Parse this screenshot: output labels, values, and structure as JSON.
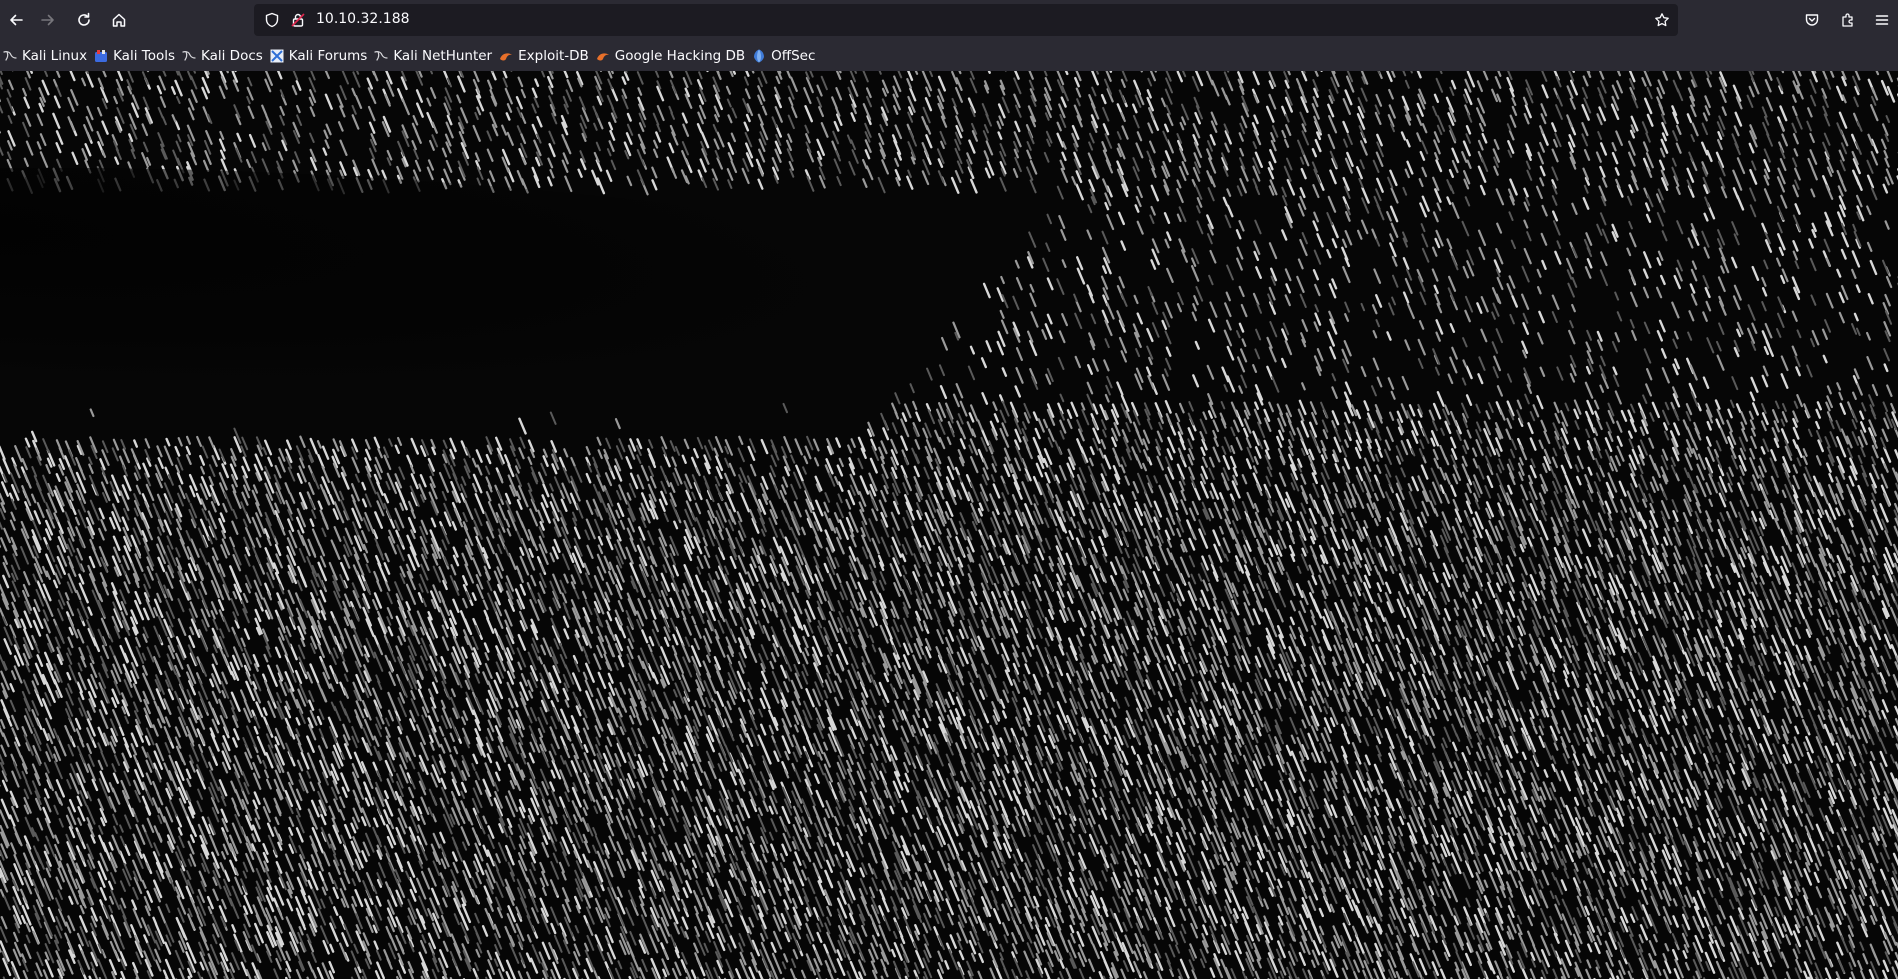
{
  "window": {
    "url": "10.10.32.188"
  },
  "toolbar": {
    "icons": [
      "back-arrow-icon",
      "forward-arrow-icon",
      "reload-icon",
      "home-icon",
      "tracking-shield-icon",
      "insecure-lock-icon",
      "bookmark-star-icon",
      "pocket-icon",
      "extensions-icon",
      "menu-icon"
    ]
  },
  "bookmarks": [
    {
      "label": "Kali Linux",
      "icon": "kali-dragon-icon"
    },
    {
      "label": "Kali Tools",
      "icon": "kali-tools-icon"
    },
    {
      "label": "Kali Docs",
      "icon": "kali-dragon-icon"
    },
    {
      "label": "Kali Forums",
      "icon": "kali-forums-icon"
    },
    {
      "label": "Kali NetHunter",
      "icon": "kali-dragon-icon"
    },
    {
      "label": "Exploit-DB",
      "icon": "exploit-db-icon"
    },
    {
      "label": "Google Hacking DB",
      "icon": "exploit-db-icon"
    },
    {
      "label": "OffSec",
      "icon": "offsec-icon"
    }
  ],
  "colors": {
    "chrome_bg": "#2b2a33",
    "urlbar_bg": "#1c1b22",
    "text": "#fbfbfe",
    "page_bg": "#050505",
    "insecure_lock": "#e22850"
  }
}
